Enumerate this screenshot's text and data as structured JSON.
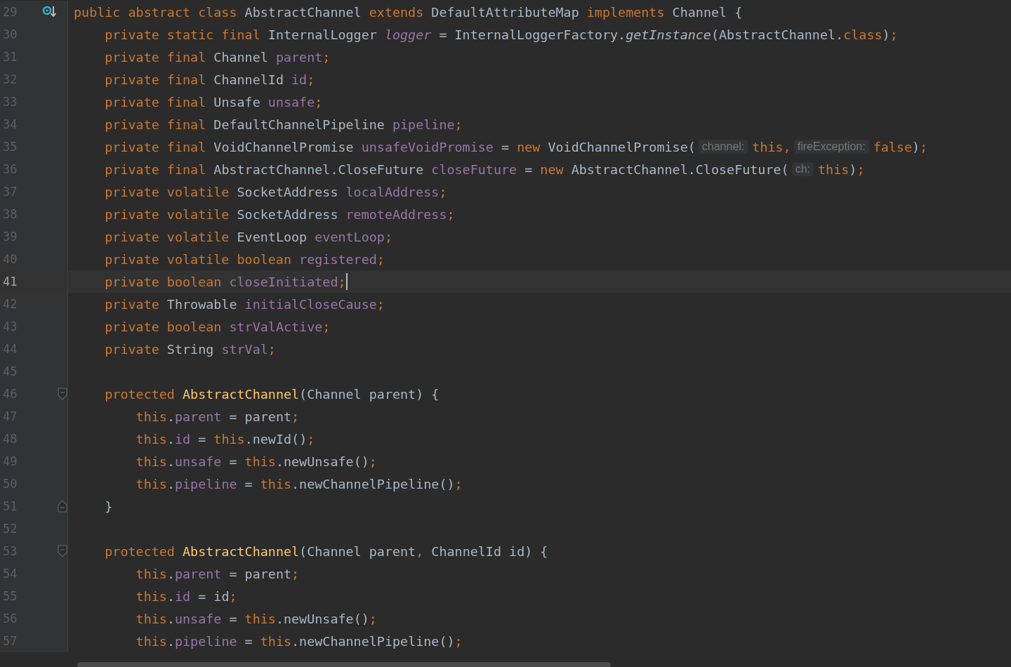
{
  "editor": {
    "lines": [
      {
        "number": "29",
        "current": false,
        "kind": "marker",
        "tokens": [
          {
            "kind": "kw",
            "text": "public abstract class"
          },
          {
            "kind": "plain",
            "text": " AbstractChannel "
          },
          {
            "kind": "kw",
            "text": "extends"
          },
          {
            "kind": "plain",
            "text": " DefaultAttributeMap "
          },
          {
            "kind": "kw",
            "text": "implements"
          },
          {
            "kind": "plain",
            "text": " Channel {"
          }
        ]
      },
      {
        "number": "30",
        "current": false,
        "tokens": [
          {
            "kind": "kw",
            "text": "    private static final"
          },
          {
            "kind": "plain",
            "text": " InternalLogger "
          },
          {
            "kind": "static",
            "text": "logger"
          },
          {
            "kind": "plain",
            "text": " = InternalLoggerFactory."
          },
          {
            "kind": "italic",
            "text": "getInstance"
          },
          {
            "kind": "plain",
            "text": "(AbstractChannel."
          },
          {
            "kind": "kw",
            "text": "class"
          },
          {
            "kind": "plain",
            "text": ")"
          },
          {
            "kind": "kw",
            "text": ";"
          }
        ]
      },
      {
        "number": "31",
        "current": false,
        "tokens": [
          {
            "kind": "kw",
            "text": "    private final"
          },
          {
            "kind": "plain",
            "text": " Channel "
          },
          {
            "kind": "field",
            "text": "parent"
          },
          {
            "kind": "kw",
            "text": ";"
          }
        ]
      },
      {
        "number": "32",
        "current": false,
        "tokens": [
          {
            "kind": "kw",
            "text": "    private final"
          },
          {
            "kind": "plain",
            "text": " ChannelId "
          },
          {
            "kind": "field",
            "text": "id"
          },
          {
            "kind": "kw",
            "text": ";"
          }
        ]
      },
      {
        "number": "33",
        "current": false,
        "tokens": [
          {
            "kind": "kw",
            "text": "    private final"
          },
          {
            "kind": "plain",
            "text": " Unsafe "
          },
          {
            "kind": "field",
            "text": "unsafe"
          },
          {
            "kind": "kw",
            "text": ";"
          }
        ]
      },
      {
        "number": "34",
        "current": false,
        "tokens": [
          {
            "kind": "kw",
            "text": "    private final"
          },
          {
            "kind": "plain",
            "text": " DefaultChannelPipeline "
          },
          {
            "kind": "field",
            "text": "pipeline"
          },
          {
            "kind": "kw",
            "text": ";"
          }
        ]
      },
      {
        "number": "35",
        "current": false,
        "tokens": [
          {
            "kind": "kw",
            "text": "    private final"
          },
          {
            "kind": "plain",
            "text": " VoidChannelPromise "
          },
          {
            "kind": "field",
            "text": "unsafeVoidPromise"
          },
          {
            "kind": "plain",
            "text": " = "
          },
          {
            "kind": "kw",
            "text": "new"
          },
          {
            "kind": "plain",
            "text": " VoidChannelPromise("
          },
          {
            "kind": "hint",
            "text": "channel:"
          },
          {
            "kind": "kw",
            "text": "this,"
          },
          {
            "kind": "hint",
            "text": "fireException:"
          },
          {
            "kind": "kw",
            "text": "false"
          },
          {
            "kind": "plain",
            "text": ")"
          },
          {
            "kind": "kw",
            "text": ";"
          }
        ]
      },
      {
        "number": "36",
        "current": false,
        "tokens": [
          {
            "kind": "kw",
            "text": "    private final"
          },
          {
            "kind": "plain",
            "text": " AbstractChannel.CloseFuture "
          },
          {
            "kind": "field",
            "text": "closeFuture"
          },
          {
            "kind": "plain",
            "text": " = "
          },
          {
            "kind": "kw",
            "text": "new"
          },
          {
            "kind": "plain",
            "text": " AbstractChannel.CloseFuture("
          },
          {
            "kind": "hint",
            "text": "ch:"
          },
          {
            "kind": "kw",
            "text": "this"
          },
          {
            "kind": "plain",
            "text": ")"
          },
          {
            "kind": "kw",
            "text": ";"
          }
        ]
      },
      {
        "number": "37",
        "current": false,
        "tokens": [
          {
            "kind": "kw",
            "text": "    private volatile"
          },
          {
            "kind": "plain",
            "text": " SocketAddress "
          },
          {
            "kind": "field",
            "text": "localAddress"
          },
          {
            "kind": "kw",
            "text": ";"
          }
        ]
      },
      {
        "number": "38",
        "current": false,
        "tokens": [
          {
            "kind": "kw",
            "text": "    private volatile"
          },
          {
            "kind": "plain",
            "text": " SocketAddress "
          },
          {
            "kind": "field",
            "text": "remoteAddress"
          },
          {
            "kind": "kw",
            "text": ";"
          }
        ]
      },
      {
        "number": "39",
        "current": false,
        "tokens": [
          {
            "kind": "kw",
            "text": "    private volatile"
          },
          {
            "kind": "plain",
            "text": " EventLoop "
          },
          {
            "kind": "field",
            "text": "eventLoop"
          },
          {
            "kind": "kw",
            "text": ";"
          }
        ]
      },
      {
        "number": "40",
        "current": false,
        "tokens": [
          {
            "kind": "kw",
            "text": "    private volatile boolean "
          },
          {
            "kind": "field",
            "text": "registered"
          },
          {
            "kind": "kw",
            "text": ";"
          }
        ]
      },
      {
        "number": "41",
        "current": true,
        "tokens": [
          {
            "kind": "kw",
            "text": "    private boolean "
          },
          {
            "kind": "field",
            "text": "closeInitiated"
          },
          {
            "kind": "kw",
            "text": ";"
          }
        ]
      },
      {
        "number": "42",
        "current": false,
        "tokens": [
          {
            "kind": "kw",
            "text": "    private"
          },
          {
            "kind": "plain",
            "text": " Throwable "
          },
          {
            "kind": "field",
            "text": "initialCloseCause"
          },
          {
            "kind": "kw",
            "text": ";"
          }
        ]
      },
      {
        "number": "43",
        "current": false,
        "tokens": [
          {
            "kind": "kw",
            "text": "    private boolean "
          },
          {
            "kind": "field",
            "text": "strValActive"
          },
          {
            "kind": "kw",
            "text": ";"
          }
        ]
      },
      {
        "number": "44",
        "current": false,
        "tokens": [
          {
            "kind": "kw",
            "text": "    private"
          },
          {
            "kind": "plain",
            "text": " String "
          },
          {
            "kind": "field",
            "text": "strVal"
          },
          {
            "kind": "kw",
            "text": ";"
          }
        ]
      },
      {
        "number": "45",
        "current": false
      },
      {
        "number": "46",
        "current": false,
        "kind": "fold-start",
        "tokens": [
          {
            "kind": "kw",
            "text": "    protected "
          },
          {
            "kind": "decl",
            "text": "AbstractChannel"
          },
          {
            "kind": "plain",
            "text": "(Channel parent) {"
          }
        ]
      },
      {
        "number": "47",
        "current": false,
        "tokens": [
          {
            "kind": "kw",
            "text": "        this"
          },
          {
            "kind": "plain",
            "text": "."
          },
          {
            "kind": "field",
            "text": "parent"
          },
          {
            "kind": "plain",
            "text": " = parent"
          },
          {
            "kind": "kw",
            "text": ";"
          }
        ]
      },
      {
        "number": "48",
        "current": false,
        "tokens": [
          {
            "kind": "kw",
            "text": "        this"
          },
          {
            "kind": "plain",
            "text": "."
          },
          {
            "kind": "field",
            "text": "id"
          },
          {
            "kind": "plain",
            "text": " = "
          },
          {
            "kind": "kw",
            "text": "this"
          },
          {
            "kind": "plain",
            "text": ".newId()"
          },
          {
            "kind": "kw",
            "text": ";"
          }
        ]
      },
      {
        "number": "49",
        "current": false,
        "tokens": [
          {
            "kind": "kw",
            "text": "        this"
          },
          {
            "kind": "plain",
            "text": "."
          },
          {
            "kind": "field",
            "text": "unsafe"
          },
          {
            "kind": "plain",
            "text": " = "
          },
          {
            "kind": "kw",
            "text": "this"
          },
          {
            "kind": "plain",
            "text": ".newUnsafe()"
          },
          {
            "kind": "kw",
            "text": ";"
          }
        ]
      },
      {
        "number": "50",
        "current": false,
        "tokens": [
          {
            "kind": "kw",
            "text": "        this"
          },
          {
            "kind": "plain",
            "text": "."
          },
          {
            "kind": "field",
            "text": "pipeline"
          },
          {
            "kind": "plain",
            "text": " = "
          },
          {
            "kind": "kw",
            "text": "this"
          },
          {
            "kind": "plain",
            "text": ".newChannelPipeline()"
          },
          {
            "kind": "kw",
            "text": ";"
          }
        ]
      },
      {
        "number": "51",
        "current": false,
        "kind": "fold-end",
        "tokens": [
          {
            "kind": "plain",
            "text": "    }"
          }
        ]
      },
      {
        "number": "52",
        "current": false
      },
      {
        "number": "53",
        "current": false,
        "kind": "fold-start",
        "tokens": [
          {
            "kind": "kw",
            "text": "    protected "
          },
          {
            "kind": "decl",
            "text": "AbstractChannel"
          },
          {
            "kind": "plain",
            "text": "(Channel parent"
          },
          {
            "kind": "kw",
            "text": ","
          },
          {
            "kind": "plain",
            "text": " ChannelId id) {"
          }
        ]
      },
      {
        "number": "54",
        "current": false,
        "tokens": [
          {
            "kind": "kw",
            "text": "        this"
          },
          {
            "kind": "plain",
            "text": "."
          },
          {
            "kind": "field",
            "text": "parent"
          },
          {
            "kind": "plain",
            "text": " = parent"
          },
          {
            "kind": "kw",
            "text": ";"
          }
        ]
      },
      {
        "number": "55",
        "current": false,
        "tokens": [
          {
            "kind": "kw",
            "text": "        this"
          },
          {
            "kind": "plain",
            "text": "."
          },
          {
            "kind": "field",
            "text": "id"
          },
          {
            "kind": "plain",
            "text": " = id"
          },
          {
            "kind": "kw",
            "text": ";"
          }
        ]
      },
      {
        "number": "56",
        "current": false,
        "tokens": [
          {
            "kind": "kw",
            "text": "        this"
          },
          {
            "kind": "plain",
            "text": "."
          },
          {
            "kind": "field",
            "text": "unsafe"
          },
          {
            "kind": "plain",
            "text": " = "
          },
          {
            "kind": "kw",
            "text": "this"
          },
          {
            "kind": "plain",
            "text": ".newUnsafe()"
          },
          {
            "kind": "kw",
            "text": ";"
          }
        ]
      },
      {
        "number": "57",
        "current": false,
        "tokens": [
          {
            "kind": "kw",
            "text": "        this"
          },
          {
            "kind": "plain",
            "text": "."
          },
          {
            "kind": "field",
            "text": "pipeline"
          },
          {
            "kind": "plain",
            "text": " = "
          },
          {
            "kind": "kw",
            "text": "this"
          },
          {
            "kind": "plain",
            "text": ".newChannelPipeline()"
          },
          {
            "kind": "kw",
            "text": ";"
          }
        ]
      }
    ]
  }
}
